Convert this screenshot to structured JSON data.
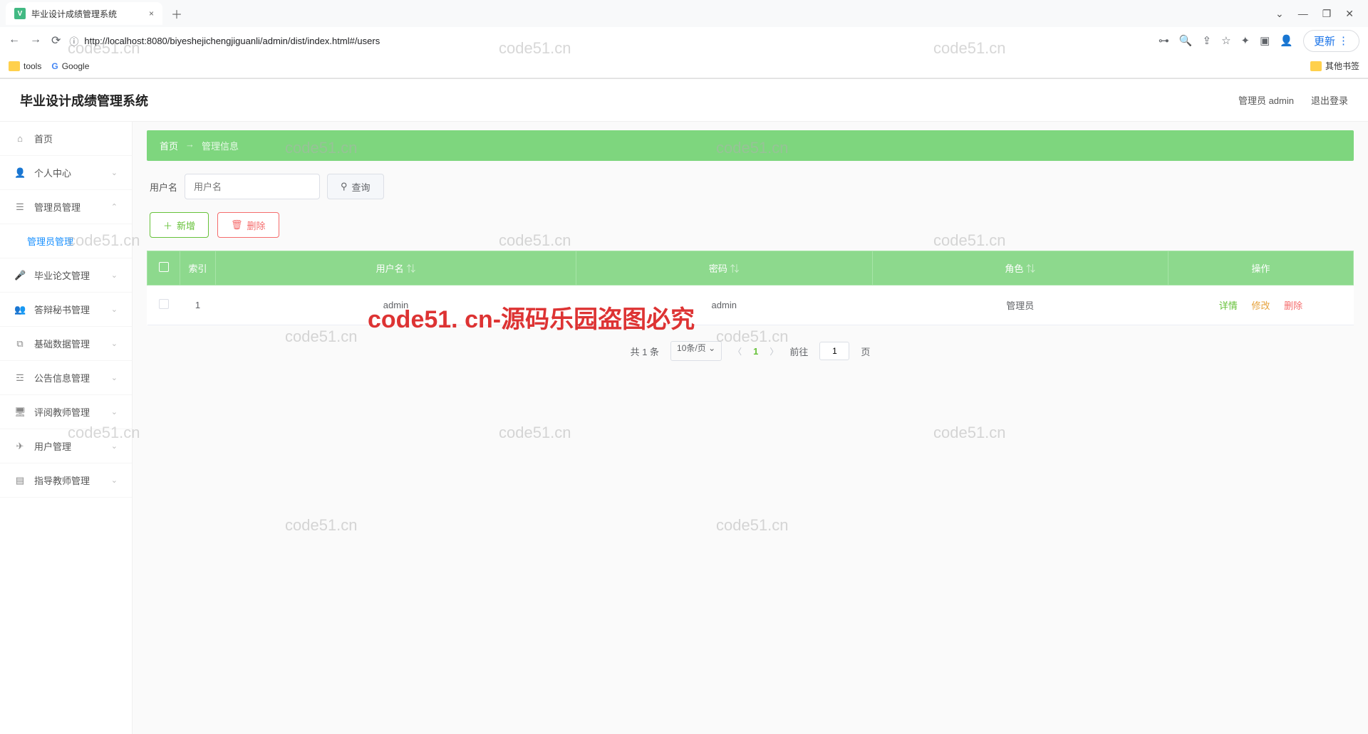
{
  "browser": {
    "tab_title": "毕业设计成绩管理系统",
    "url": "http://localhost:8080/biyeshejichengjiguanli/admin/dist/index.html#/users",
    "update_btn": "更新",
    "bookmarks": [
      "tools",
      "Google"
    ],
    "other_bookmarks": "其他书签"
  },
  "header": {
    "title": "毕业设计成绩管理系统",
    "user": "管理员 admin",
    "logout": "退出登录"
  },
  "sidebar": {
    "items": [
      {
        "icon": "⌂",
        "label": "首页"
      },
      {
        "icon": "👤",
        "label": "个人中心",
        "expandable": true
      },
      {
        "icon": "☰",
        "label": "管理员管理",
        "expandable": true,
        "expanded": true
      },
      {
        "icon": "",
        "label": "管理员管理",
        "sub": true
      },
      {
        "icon": "🎤",
        "label": "毕业论文管理",
        "expandable": true
      },
      {
        "icon": "👥",
        "label": "答辩秘书管理",
        "expandable": true
      },
      {
        "icon": "⧉",
        "label": "基础数据管理",
        "expandable": true
      },
      {
        "icon": "☲",
        "label": "公告信息管理",
        "expandable": true
      },
      {
        "icon": "🖥",
        "label": "评阅教师管理",
        "expandable": true
      },
      {
        "icon": "✈",
        "label": "用户管理",
        "expandable": true
      },
      {
        "icon": "▤",
        "label": "指导教师管理",
        "expandable": true
      }
    ]
  },
  "breadcrumb": {
    "home": "首页",
    "sep": "→",
    "current": "管理信息"
  },
  "search": {
    "label": "用户名",
    "placeholder": "用户名",
    "btn": "查询"
  },
  "actions": {
    "add": "新增",
    "delete": "删除"
  },
  "table": {
    "headers": [
      "",
      "索引",
      "用户名",
      "密码",
      "角色",
      "操作"
    ],
    "rows": [
      {
        "index": "1",
        "username": "admin",
        "password": "admin",
        "role": "管理员"
      }
    ],
    "ops": {
      "detail": "详情",
      "edit": "修改",
      "delete": "删除"
    }
  },
  "pagination": {
    "total": "共 1 条",
    "per_page": "10条/页",
    "current": "1",
    "goto_label": "前往",
    "goto_value": "1",
    "goto_suffix": "页"
  },
  "watermarks": {
    "text": "code51.cn",
    "big": "code51. cn-源码乐园盗图必究"
  }
}
